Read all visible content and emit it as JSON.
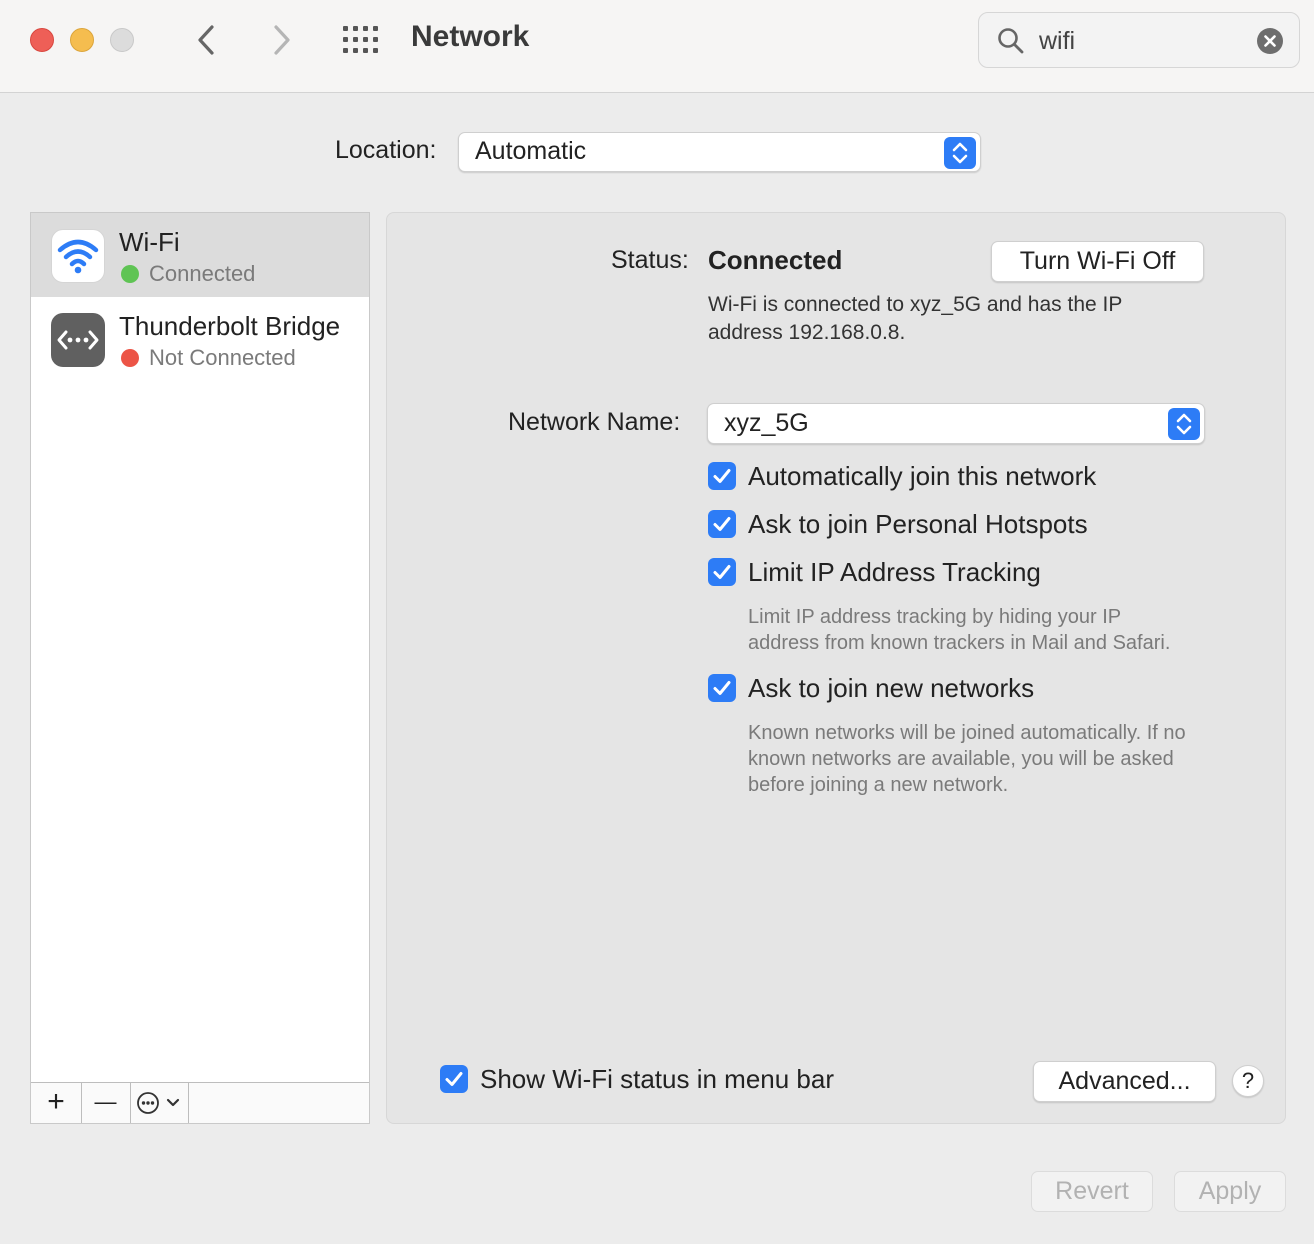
{
  "window": {
    "title": "Network",
    "search_value": "wifi"
  },
  "location": {
    "label": "Location:",
    "value": "Automatic"
  },
  "sidebar": {
    "services": [
      {
        "name": "Wi-Fi",
        "status": "Connected",
        "status_color": "#5fc454"
      },
      {
        "name": "Thunderbolt Bridge",
        "status": "Not Connected",
        "status_color": "#ec5446"
      }
    ],
    "add_label": "+",
    "remove_label": "—"
  },
  "detail": {
    "status_label": "Status:",
    "status_value": "Connected",
    "toggle_button": "Turn Wi-Fi Off",
    "status_desc_line1": "Wi-Fi is connected to xyz_5G and has the IP",
    "status_desc_line2": "address 192.168.0.8.",
    "network_name_label": "Network Name:",
    "network_name_value": "xyz_5G",
    "options": [
      {
        "label": "Automatically join this network",
        "checked": true
      },
      {
        "label": "Ask to join Personal Hotspots",
        "checked": true
      },
      {
        "label": "Limit IP Address Tracking",
        "checked": true
      },
      {
        "label": "Ask to join new networks",
        "checked": true
      }
    ],
    "limit_ip_desc_line1": "Limit IP address tracking by hiding your IP",
    "limit_ip_desc_line2": "address from known trackers in Mail and Safari.",
    "new_networks_desc_line1": "Known networks will be joined automatically. If no",
    "new_networks_desc_line2": "known networks are available, you will be asked",
    "new_networks_desc_line3": "before joining a new network.",
    "menu_bar_label": "Show Wi-Fi status in menu bar",
    "advanced_button": "Advanced...",
    "help_label": "?"
  },
  "footer": {
    "revert_button": "Revert",
    "apply_button": "Apply"
  },
  "colors": {
    "accent": "#2d7cf6"
  }
}
